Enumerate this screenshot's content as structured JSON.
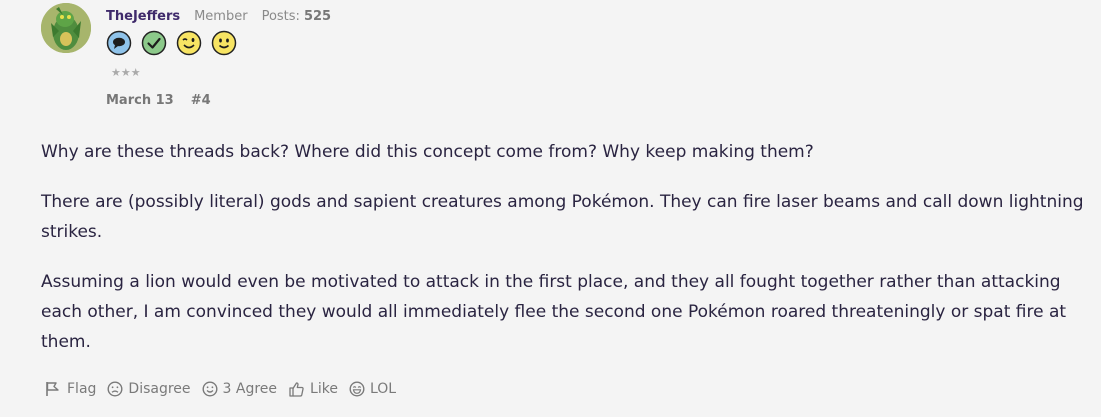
{
  "post": {
    "author": {
      "username": "TheJeffers",
      "role": "Member",
      "posts_label": "Posts:",
      "posts_count": "525",
      "stars": "★★★",
      "badges": [
        {
          "icon": "speech-bubble-icon",
          "color": "#8fc3ea"
        },
        {
          "icon": "checkmark-icon",
          "color": "#8cc98a"
        },
        {
          "icon": "wink-face-icon",
          "color": "#f7e463"
        },
        {
          "icon": "smile-face-icon",
          "color": "#f7e463"
        }
      ]
    },
    "date": "March 13",
    "post_number": "#4",
    "paragraphs": [
      "Why are these threads back? Where did this concept come from? Why keep making them?",
      "There are (possibly literal) gods and sapient creatures among Pokémon. They can fire laser beams and call down lightning strikes.",
      "Assuming a lion would even be motivated to attack in the first place, and they all fought together rather than attacking each other, I am convinced they would all immediately flee the second one Pokémon roared threateningly or spat fire at them."
    ],
    "actions": {
      "flag": "Flag",
      "disagree": "Disagree",
      "agree": "3 Agree",
      "like": "Like",
      "lol": "LOL"
    }
  },
  "colors": {
    "background": "#f4f4f4",
    "text": "#2a2441",
    "username": "#3f2a6b",
    "muted": "#7a7a7a"
  }
}
